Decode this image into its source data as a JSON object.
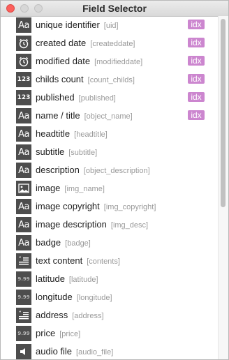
{
  "window": {
    "title": "Field Selector"
  },
  "fields": [
    {
      "label": "unique identifier",
      "field": "[uid]",
      "icon": "text",
      "badge": "idx"
    },
    {
      "label": "created date",
      "field": "[createddate]",
      "icon": "clock",
      "badge": "idx"
    },
    {
      "label": "modified date",
      "field": "[modifieddate]",
      "icon": "clock",
      "badge": "idx"
    },
    {
      "label": "childs count",
      "field": "[count_childs]",
      "icon": "number",
      "badge": "idx"
    },
    {
      "label": "published",
      "field": "[published]",
      "icon": "number",
      "badge": "idx"
    },
    {
      "label": "name / title",
      "field": "[object_name]",
      "icon": "text",
      "badge": "idx"
    },
    {
      "label": "headtitle",
      "field": "[headtitle]",
      "icon": "text"
    },
    {
      "label": "subtitle",
      "field": "[subtitle]",
      "icon": "text"
    },
    {
      "label": "description",
      "field": "[object_description]",
      "icon": "text"
    },
    {
      "label": "image",
      "field": "[img_name]",
      "icon": "image"
    },
    {
      "label": "image copyright",
      "field": "[img_copyright]",
      "icon": "text"
    },
    {
      "label": "image description",
      "field": "[img_desc]",
      "icon": "text"
    },
    {
      "label": "badge",
      "field": "[badge]",
      "icon": "text"
    },
    {
      "label": "text content",
      "field": "[contents]",
      "icon": "richtext"
    },
    {
      "label": "latitude",
      "field": "[latitude]",
      "icon": "decimal"
    },
    {
      "label": "longitude",
      "field": "[longitude]",
      "icon": "decimal"
    },
    {
      "label": "address",
      "field": "[address]",
      "icon": "richtext"
    },
    {
      "label": "price",
      "field": "[price]",
      "icon": "decimal"
    },
    {
      "label": "audio file",
      "field": "[audio_file]",
      "icon": "audio"
    }
  ],
  "icons": {
    "text": "text-type-icon",
    "clock": "clock-icon",
    "number": "number-type-icon",
    "image": "image-icon",
    "richtext": "richtext-icon",
    "decimal": "decimal-type-icon",
    "audio": "speaker-icon"
  },
  "icon_glyphs": {
    "text": "Aa",
    "number": "123",
    "decimal": "9.99"
  },
  "colors": {
    "badge": "#cc86cf",
    "icon_bg": "#4d4d4d",
    "close": "#fc605c"
  }
}
